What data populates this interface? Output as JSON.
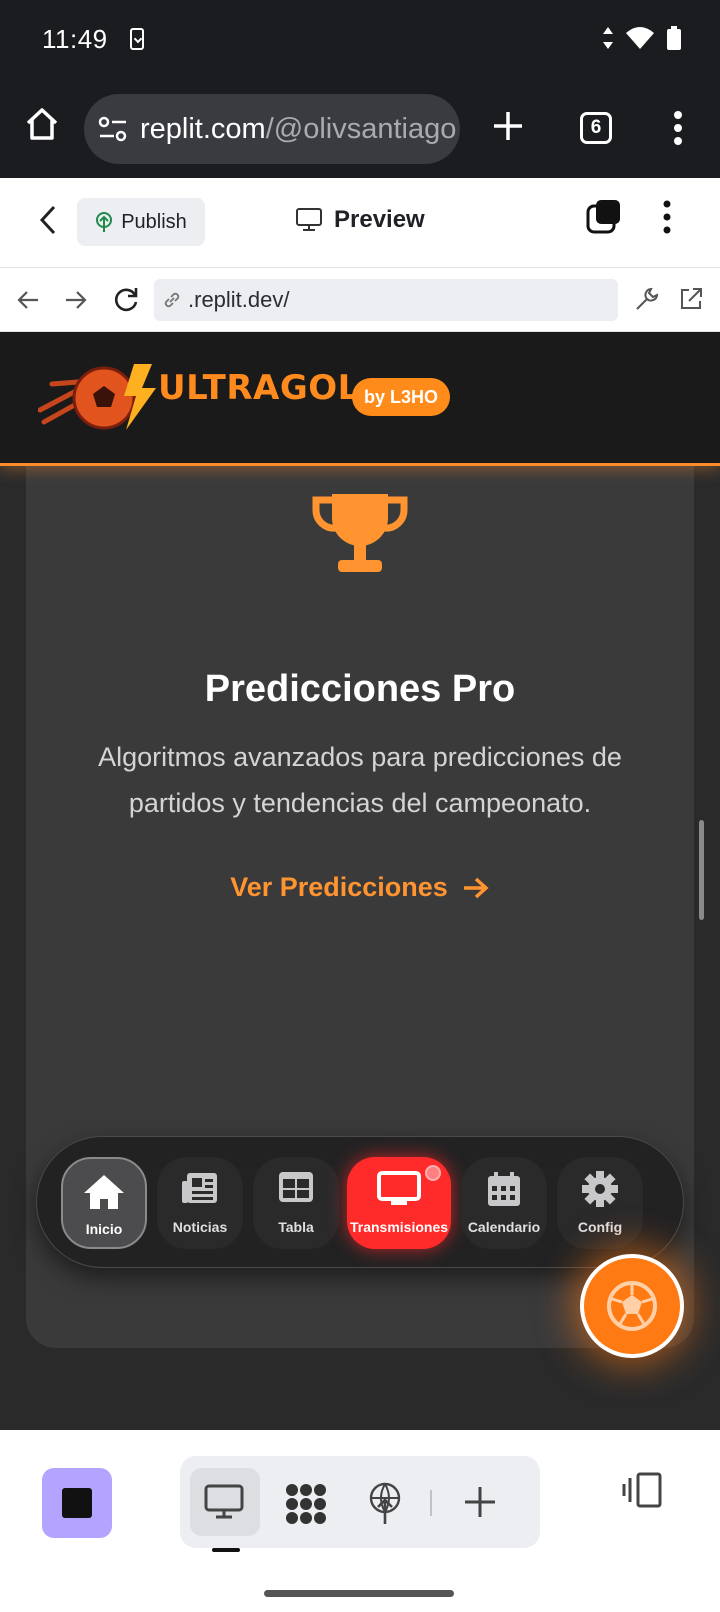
{
  "status_bar": {
    "time": "11:49"
  },
  "browser": {
    "url_host": "replit.com",
    "url_path": "/@olivsantiago",
    "tab_count": "6"
  },
  "replit_header": {
    "publish_label": "Publish",
    "preview_label": "Preview"
  },
  "address_row": {
    "address": ".replit.dev/"
  },
  "app": {
    "logo_text": "ULTRAGOL",
    "badge": "by L3HO",
    "card": {
      "title": "Predicciones Pro",
      "description": "Algoritmos avanzados para predicciones de partidos y tendencias del campeonato.",
      "link_label": "Ver Predicciones"
    },
    "nav": [
      {
        "label": "Inicio",
        "icon": "home-icon"
      },
      {
        "label": "Noticias",
        "icon": "newspaper-icon"
      },
      {
        "label": "Tabla",
        "icon": "table-icon"
      },
      {
        "label": "Transmisiones",
        "icon": "tv-icon"
      },
      {
        "label": "Calendario",
        "icon": "calendar-icon"
      },
      {
        "label": "Config",
        "icon": "gear-icon"
      }
    ]
  },
  "colors": {
    "accent": "#ff8c1a",
    "live": "#ff2a2a",
    "stop": "#b4a4ff"
  }
}
